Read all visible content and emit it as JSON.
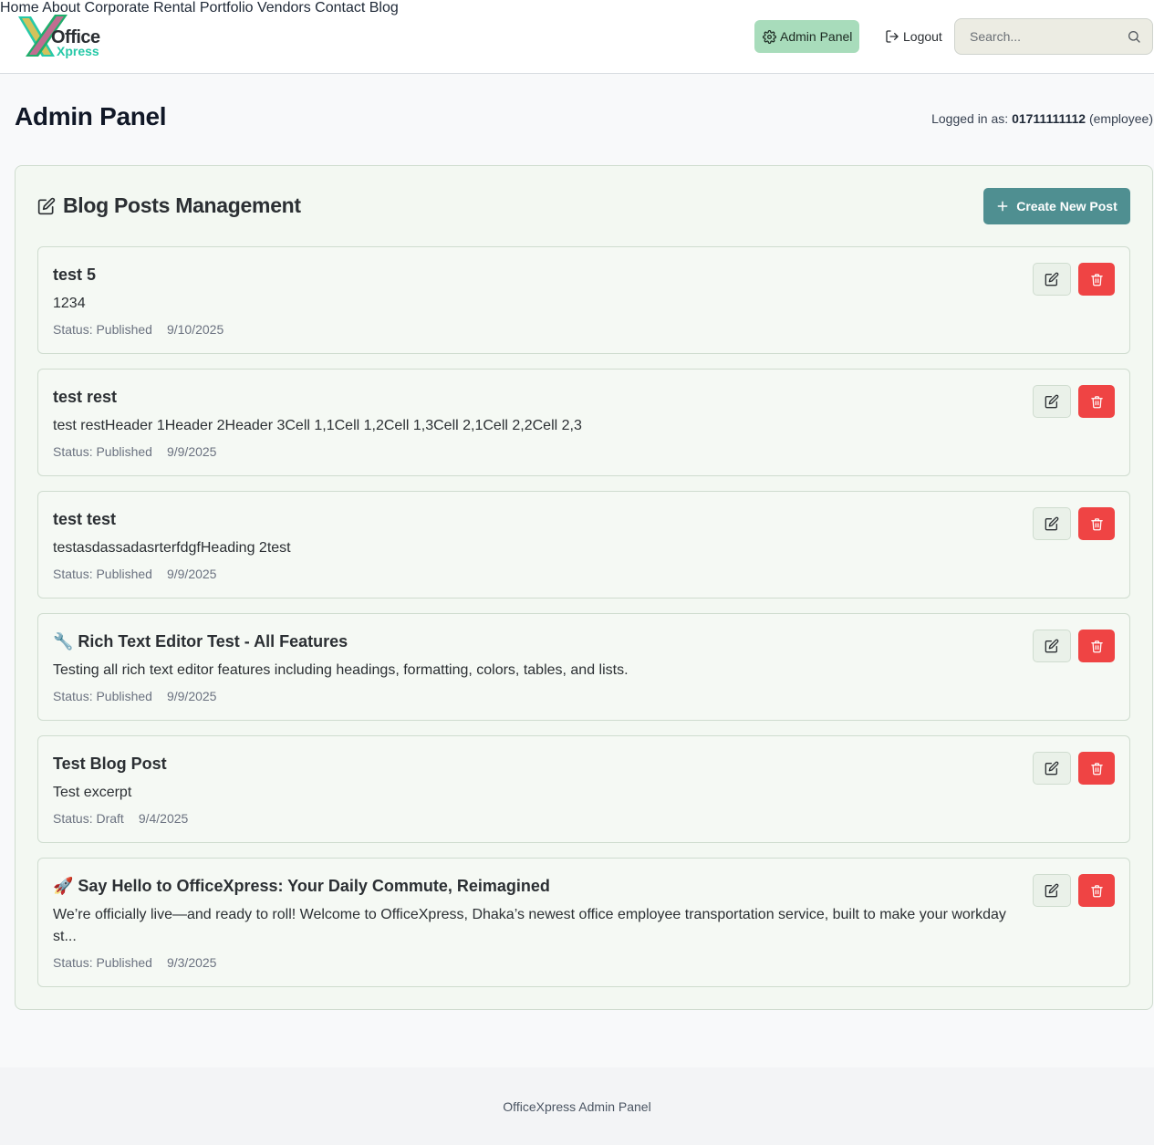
{
  "brand": {
    "line1": "Office",
    "line2": "Xpress"
  },
  "nav": {
    "items": [
      "Home",
      "About",
      "Corporate",
      "Rental",
      "Portfolio",
      "Vendors",
      "Contact",
      "Blog"
    ],
    "admin_label": "Admin Panel",
    "logout_label": "Logout"
  },
  "search": {
    "placeholder": "Search..."
  },
  "page": {
    "title": "Admin Panel",
    "logged_in_prefix": "Logged in as:",
    "user": "01711111112",
    "role": "(employee)"
  },
  "blog": {
    "section_title": "Blog Posts Management",
    "create_label": "Create New Post",
    "posts": [
      {
        "title": "test 5",
        "excerpt": "1234",
        "status": "Status: Published",
        "date": "9/10/2025"
      },
      {
        "title": "test rest",
        "excerpt": "test restHeader 1Header 2Header 3Cell 1,1Cell 1,2Cell 1,3Cell 2,1Cell 2,2Cell 2,3",
        "status": "Status: Published",
        "date": "9/9/2025"
      },
      {
        "title": "test test",
        "excerpt": "testasdassadasrterfdgfHeading 2test",
        "status": "Status: Published",
        "date": "9/9/2025"
      },
      {
        "title": "🔧 Rich Text Editor Test - All Features",
        "excerpt": "Testing all rich text editor features including headings, formatting, colors, tables, and lists.",
        "status": "Status: Published",
        "date": "9/9/2025"
      },
      {
        "title": "Test Blog Post",
        "excerpt": "Test excerpt",
        "status": "Status: Draft",
        "date": "9/4/2025"
      },
      {
        "title": "🚀 Say Hello to OfficeXpress: Your Daily Commute, Reimagined",
        "excerpt": "We’re officially live—and ready to roll! Welcome to OfficeXpress, Dhaka’s newest office employee transportation service, built to make your workday st...",
        "status": "Status: Published",
        "date": "9/3/2025"
      }
    ]
  },
  "footer": {
    "text": "OfficeXpress Admin Panel"
  },
  "colors": {
    "accent": "#4f8f91",
    "admin_pill": "#a8dcbb",
    "danger": "#ef4444",
    "brand_teal": "#27c9a8"
  }
}
